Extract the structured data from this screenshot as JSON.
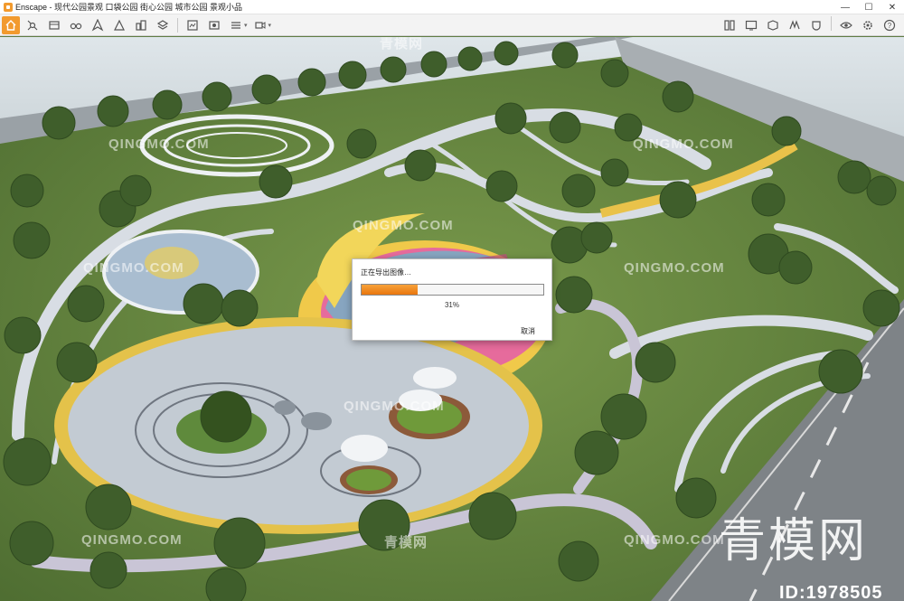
{
  "window": {
    "title": "Enscape - 现代公园景观 口袋公园 街心公园 城市公园 景观小品",
    "controls": {
      "minimize": "—",
      "maximize": "☐",
      "close": "✕"
    }
  },
  "toolbar": {
    "left_icons": [
      "home-icon",
      "satellite-icon",
      "bim-icon",
      "binoculars-icon",
      "compass-icon",
      "perspective-icon",
      "buildings-icon",
      "layers-icon",
      "export-image-icon",
      "render-icon",
      "batch-icon",
      "video-icon"
    ],
    "right_icons": [
      "asset-library-icon",
      "screen-icon",
      "materials-icon",
      "sketch-icon",
      "quality-icon",
      "visibility-icon",
      "settings-icon",
      "help-icon"
    ],
    "collapse_glyph": "︿"
  },
  "viewport": {
    "watermarks": [
      "QINGMO.COM",
      "QINGMO.COM",
      "QINGMO.COM",
      "QINGMO.COM",
      "QINGMO.COM",
      "QINGMO.COM",
      "QINGMO.COM",
      "QINGMO.COM",
      "青模网",
      "青模网"
    ],
    "brand_watermark": "青模网",
    "id_label": "ID:1978505"
  },
  "dialog": {
    "title": "正在导出图像…",
    "progress_percent": 31,
    "progress_label": "31%",
    "cancel_label": "取消",
    "accent_color": "#f29a2e"
  }
}
